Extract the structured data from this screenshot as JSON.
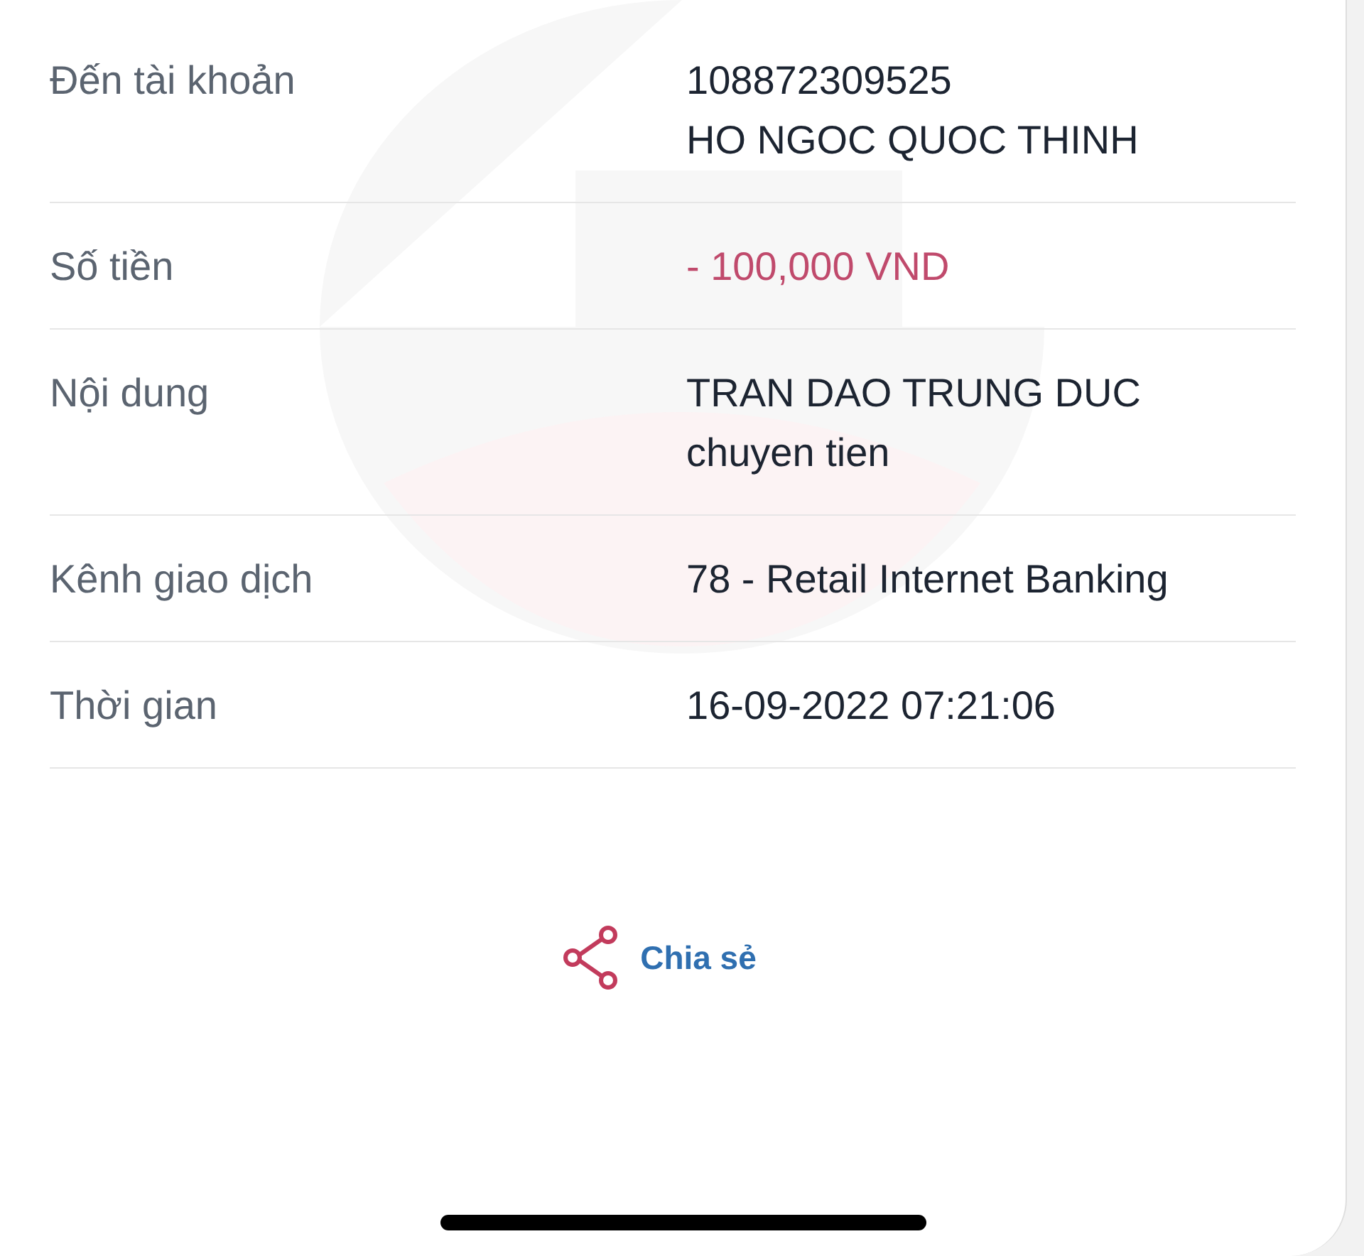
{
  "details": [
    {
      "label": "Đến tài khoản",
      "lines": [
        "108872309525",
        "HO NGOC QUOC THINH"
      ],
      "kind": "plain"
    },
    {
      "label": "Số tiền",
      "lines": [
        "- 100,000 VND"
      ],
      "kind": "amount"
    },
    {
      "label": "Nội dung",
      "lines": [
        "TRAN DAO TRUNG DUC",
        "chuyen tien"
      ],
      "kind": "plain"
    },
    {
      "label": "Kênh giao dịch",
      "lines": [
        "78 - Retail Internet Banking"
      ],
      "kind": "plain"
    },
    {
      "label": "Thời gian",
      "lines": [
        "16-09-2022 07:21:06"
      ],
      "kind": "plain"
    }
  ],
  "share_button": {
    "label": "Chia sẻ"
  }
}
